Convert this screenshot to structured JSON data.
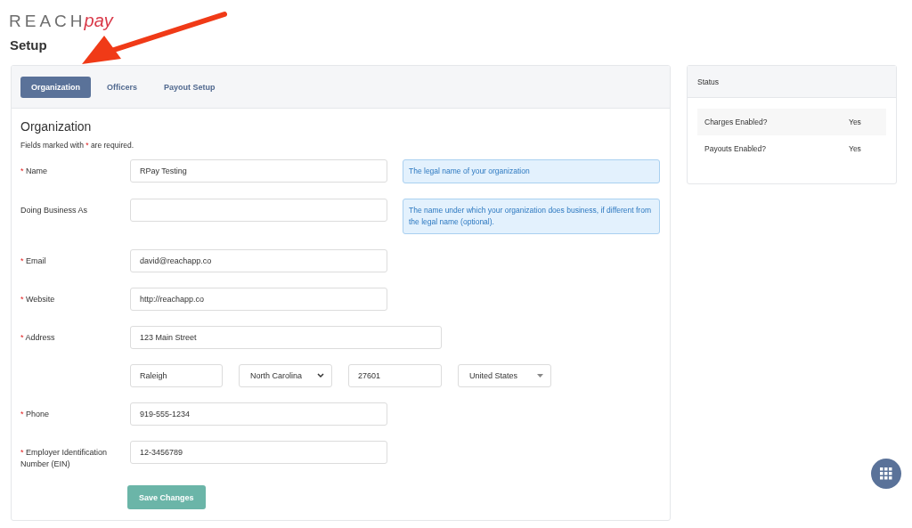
{
  "logo": {
    "text": "REACH",
    "accent": "pay"
  },
  "page_title": "Setup",
  "tabs": [
    {
      "label": "Organization",
      "selected": true
    },
    {
      "label": "Officers",
      "selected": false
    },
    {
      "label": "Payout Setup",
      "selected": false
    }
  ],
  "form": {
    "heading": "Organization",
    "note_start": "Fields marked with",
    "required_mark": "*",
    "note_end": "are required.",
    "fields": [
      {
        "kind": "input",
        "label": "Name",
        "required": true,
        "value": "RPay Testing",
        "hint": "The legal name of your organization"
      },
      {
        "kind": "input",
        "label": "Doing Business As",
        "required": false,
        "hint": "The name under which your organization does business, if different from the legal name (optional)."
      },
      {
        "kind": "input",
        "label": "Email",
        "required": true,
        "value": "david@reachapp.co"
      },
      {
        "kind": "input",
        "label": "Website",
        "required": true,
        "value": "http://reachapp.co"
      },
      {
        "kind": "address",
        "label": "Address",
        "required": true,
        "street": "123 Main Street",
        "city": "Raleigh",
        "state": "North Carolina",
        "zip": "27601",
        "country": "United States"
      },
      {
        "kind": "input",
        "label": "Phone",
        "required": true,
        "value": "919-555-1234"
      },
      {
        "kind": "input",
        "label": "Employer Identification Number (EIN)",
        "required": true,
        "value": "12-3456789"
      }
    ],
    "submit": "Save Changes"
  },
  "status": {
    "title": "Status",
    "rows": [
      {
        "label": "Charges Enabled?",
        "value": "Yes"
      },
      {
        "label": "Payouts Enabled?",
        "value": "Yes"
      }
    ]
  }
}
